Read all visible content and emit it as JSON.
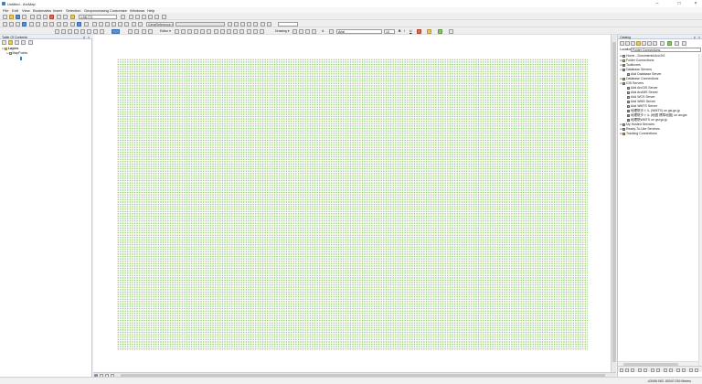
{
  "window": {
    "title": "Untitled - ArcMap",
    "minimize": "–",
    "maximize": "□",
    "close": "×"
  },
  "menu": [
    "File",
    "Edit",
    "View",
    "Bookmarks",
    "Insert",
    "Selection",
    "Geoprocessing",
    "Customize",
    "Windows",
    "Help"
  ],
  "toolbar1": {
    "scale_value": "1:58,771"
  },
  "toolbar2": {
    "layer_dropdown": "GeneReference lyr"
  },
  "toolbar3": {
    "editor_label": "Editor ▾",
    "drawing_label": "Drawing ▾",
    "font_value": "Arial",
    "font_size_value": "10",
    "bold": "B",
    "italic": "I",
    "underline": "U",
    "text_tool": "A"
  },
  "toc": {
    "title": "Table Of Contents",
    "pin": "♯",
    "close": "×",
    "root_label": "Layers",
    "layer_label": "MapPoints"
  },
  "catalog": {
    "title": "Catalog",
    "pin": "♯",
    "close": "×",
    "location_label": "Location:",
    "location_value": "Folder Connections",
    "items": [
      {
        "depth": 0,
        "expander": "⊞",
        "icon": "home-folder-icon",
        "label": "Home - Documents\\ArcGIS"
      },
      {
        "depth": 0,
        "expander": "⊞",
        "icon": "folder-connections-icon",
        "label": "Folder Connections"
      },
      {
        "depth": 0,
        "expander": "⊞",
        "icon": "toolboxes-icon",
        "label": "Toolboxes"
      },
      {
        "depth": 0,
        "expander": "⊟",
        "icon": "database-servers-icon",
        "label": "Database Servers"
      },
      {
        "depth": 1,
        "expander": "",
        "icon": "add-server-icon",
        "label": "Add Database Server"
      },
      {
        "depth": 0,
        "expander": "⊞",
        "icon": "database-connections-icon",
        "label": "Database Connections"
      },
      {
        "depth": 0,
        "expander": "⊟",
        "icon": "gis-servers-icon",
        "label": "GIS Servers"
      },
      {
        "depth": 1,
        "expander": "",
        "icon": "add-server-icon",
        "label": "Add ArcGIS Server"
      },
      {
        "depth": 1,
        "expander": "",
        "icon": "add-server-icon",
        "label": "Add ArcIMS Server"
      },
      {
        "depth": 1,
        "expander": "",
        "icon": "add-server-icon",
        "label": "Add WCS Server"
      },
      {
        "depth": 1,
        "expander": "",
        "icon": "add-server-icon",
        "label": "Add WMS Server"
      },
      {
        "depth": 1,
        "expander": "",
        "icon": "add-server-icon",
        "label": "Add WMTS Server"
      },
      {
        "depth": 1,
        "expander": "",
        "icon": "wms-server-icon",
        "label": "地理院タイル (WMTS) on gsi.go.jp"
      },
      {
        "depth": 1,
        "expander": "",
        "icon": "wms-server-icon",
        "label": "地理院タイル (地図 標準地図) on arcgis"
      },
      {
        "depth": 1,
        "expander": "",
        "icon": "wms-server-icon",
        "label": "地理院WMTS on gsi.go.jp"
      },
      {
        "depth": 0,
        "expander": "⊞",
        "icon": "hosted-services-icon",
        "label": "My Hosted Services"
      },
      {
        "depth": 0,
        "expander": "⊞",
        "icon": "ready-services-icon",
        "label": "Ready-To-Use Services"
      },
      {
        "depth": 0,
        "expander": "⊞",
        "icon": "tracking-connections-icon",
        "label": "Tracking Connections"
      }
    ]
  },
  "status": {
    "coordinates": "-43496.063  -50047.039 Meters"
  },
  "colors": {
    "points": "#90cc6e",
    "panel_header": "#e8eef6",
    "folder": "#e8c85a"
  }
}
